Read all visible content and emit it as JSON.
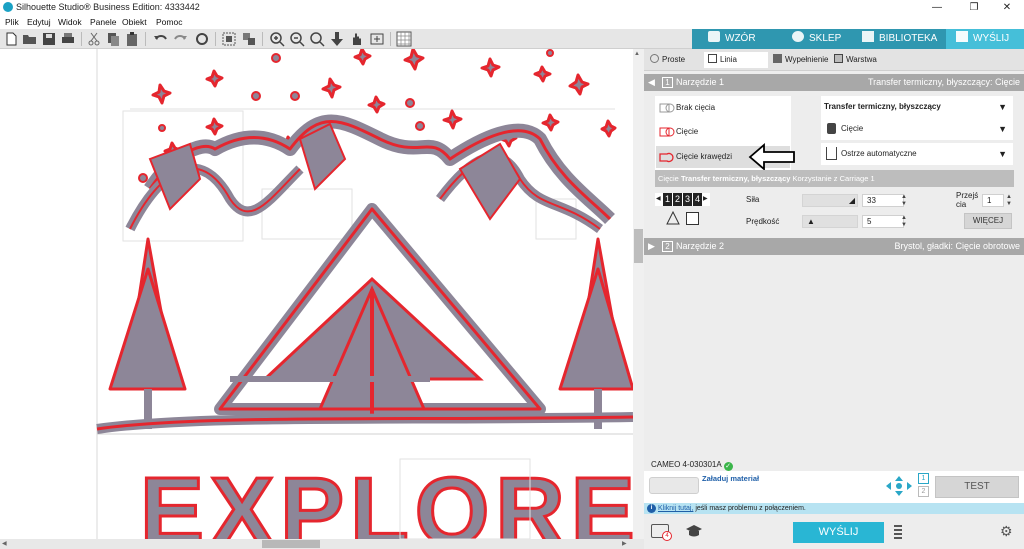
{
  "window": {
    "title": "Silhouette Studio® Business Edition: 4333442",
    "minimize": "—",
    "maximize": "❐",
    "close": "✕"
  },
  "menu": [
    "Plik",
    "Edytuj",
    "Widok",
    "Panele",
    "Obiekt",
    "Pomoc"
  ],
  "top_tabs": {
    "design": "WZÓR",
    "store": "SKLEP",
    "library": "BIBLIOTEKA",
    "send": "WYŚLIJ"
  },
  "send_panel": {
    "subtabs": [
      "Proste",
      "Linia",
      "Wypełnienie",
      "Warstwa"
    ],
    "tool1": {
      "number": "1",
      "label": "Narzędzie 1",
      "summary": "Transfer termiczny, błyszczący: Cięcie"
    },
    "cut_options": [
      "Brak cięcia",
      "Cięcie",
      "Cięcie krawędzi"
    ],
    "material": "Transfer termiczny, błyszczący",
    "action": "Cięcie",
    "blade": "Ostrze automatyczne",
    "info": {
      "prefix": "Cięcie",
      "material": "Transfer termiczny, błyszczący",
      "suffix": "Korzystanie z Carriage 1"
    },
    "passes_label": "Przejś cia",
    "passes_line1": "Przejś",
    "passes_line2": "cia",
    "passes_value": "1",
    "force_label": "Siła",
    "force_value": "33",
    "speed_label": "Prędkość",
    "speed_value": "5",
    "more_button": "WIĘCEJ",
    "carriage_digits": [
      "1",
      "2",
      "3",
      "4"
    ],
    "tool2": {
      "number": "2",
      "label": "Narzędzie 2",
      "summary": "Brystol, gładki: Cięcie obrotowe"
    }
  },
  "device": {
    "name": "CAMEO 4-030301A",
    "load_label": "Załaduj materiał",
    "carriage_1": "1",
    "carriage_2": "2",
    "test_button": "TEST"
  },
  "help_bar": {
    "link": "Kliknij tutaj,",
    "text": " jeśli masz problemu z połączeniem."
  },
  "send_button": "WYŚLIJ",
  "badge_count": "4",
  "canvas": {
    "text": "EXPLORE"
  },
  "colors": {
    "accent_teal": "#2f97b0",
    "send_button": "#29b6d4",
    "cut_red": "#e5262e",
    "shape_fill": "#8d8698",
    "help_bar": "#b7e3f2"
  }
}
